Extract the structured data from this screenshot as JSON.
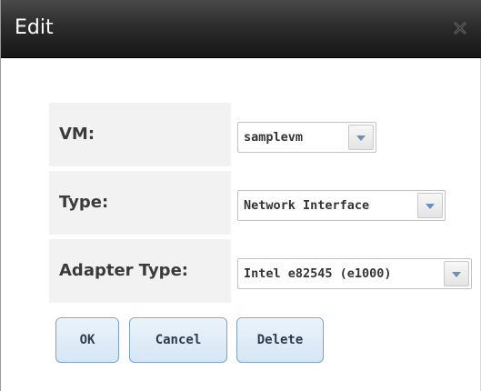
{
  "dialog": {
    "title": "Edit",
    "close_icon": "close-x-icon"
  },
  "form": {
    "vm": {
      "label": "VM:",
      "value": "samplevm"
    },
    "type": {
      "label": "Type:",
      "value": "Network Interface"
    },
    "adapter_type": {
      "label": "Adapter Type:",
      "value": "Intel e82545 (e1000)"
    }
  },
  "buttons": {
    "ok": "OK",
    "cancel": "Cancel",
    "delete": "Delete"
  }
}
